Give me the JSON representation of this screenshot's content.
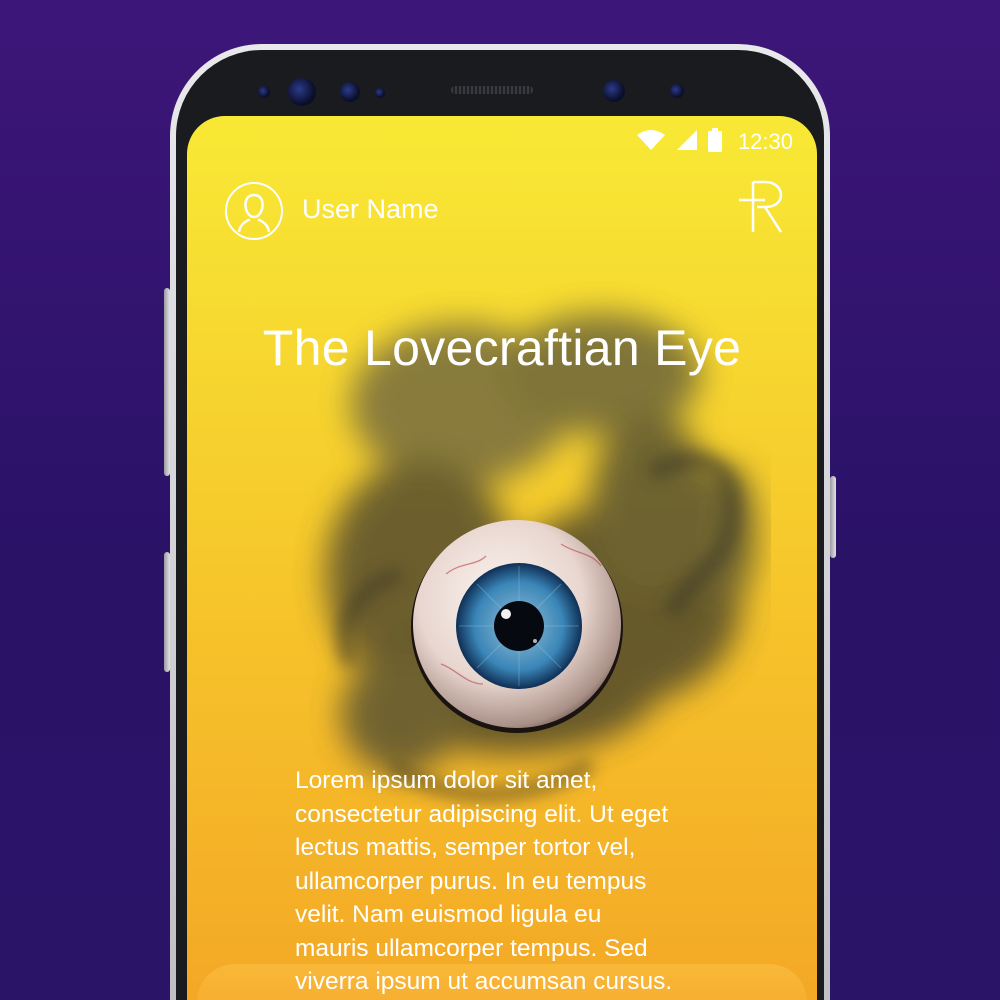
{
  "status_bar": {
    "time": "12:30",
    "icons": [
      "wifi-icon",
      "cellular-signal-icon",
      "battery-icon"
    ]
  },
  "header": {
    "user_name": "User Name",
    "avatar_icon": "user-avatar-icon",
    "logo_icon": "app-logo-icon"
  },
  "main": {
    "title": "The Lovecraftian Eye",
    "body_lines": [
      "Lorem ipsum dolor sit amet,",
      "consectetur adipiscing elit. Ut eget",
      "lectus mattis, semper tortor vel,",
      "ullamcorper purus. In eu tempus",
      "velit. Nam euismod ligula eu",
      "mauris ullamcorper tempus. Sed",
      "viverra ipsum ut accumsan cursus."
    ]
  },
  "colors": {
    "background_top": "#3d1679",
    "background_bottom": "#2a1468",
    "screen_top": "#f8e935",
    "screen_bottom": "#f4a826",
    "text": "#ffffff",
    "iris": "#3a86b8"
  }
}
